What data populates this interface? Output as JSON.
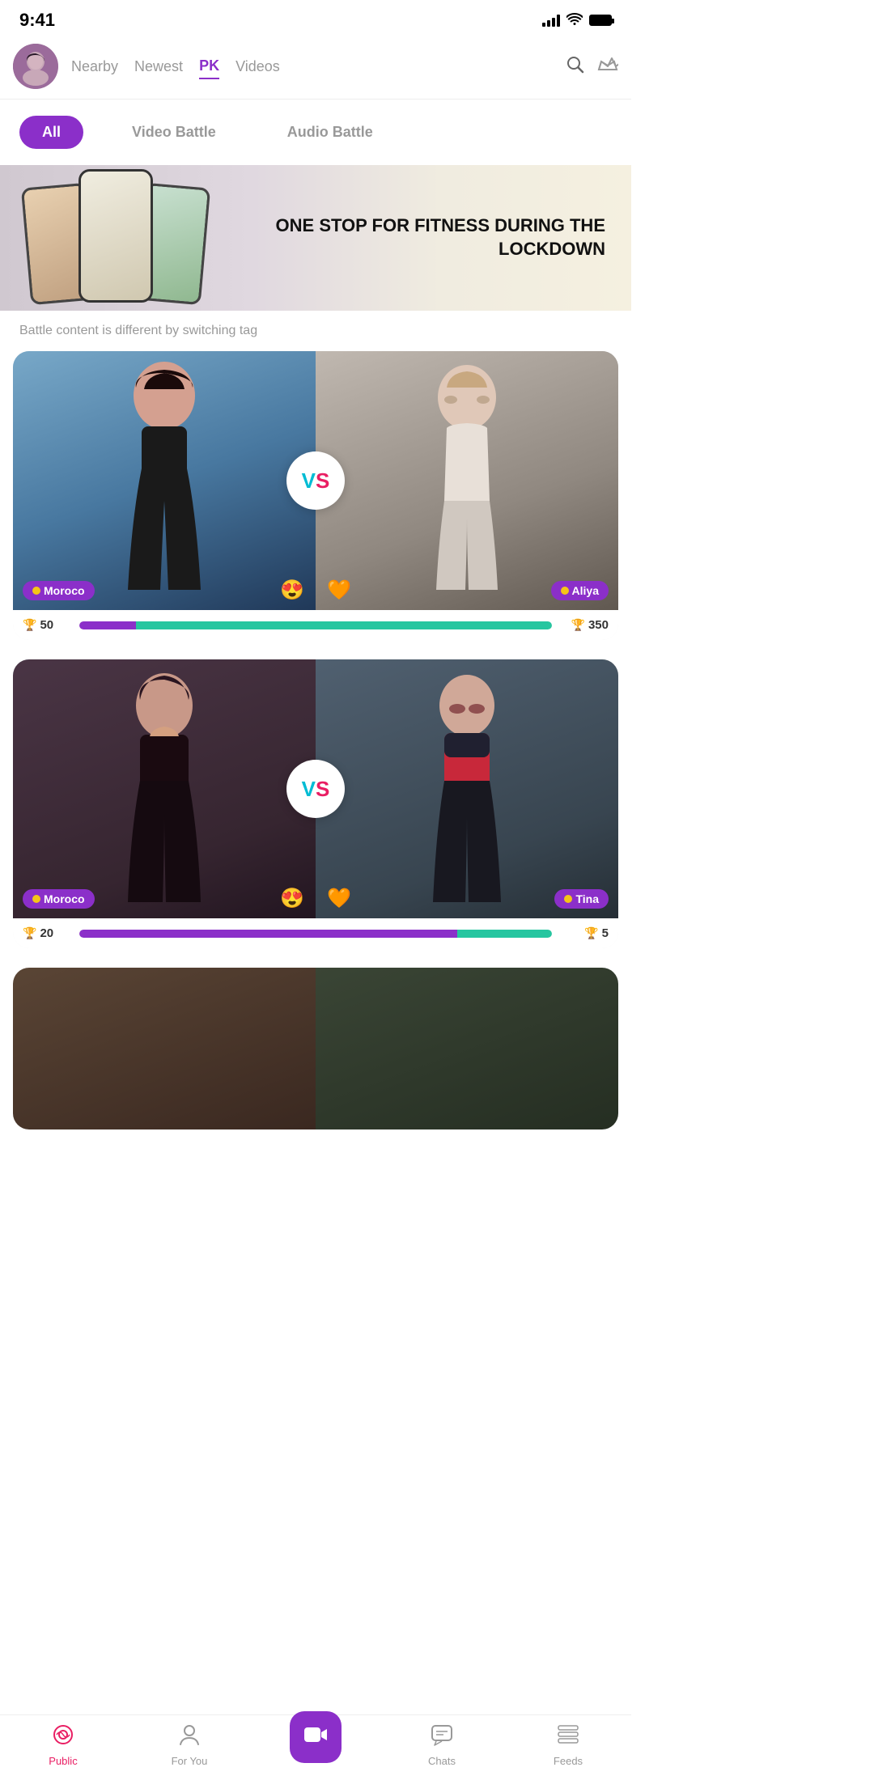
{
  "statusBar": {
    "time": "9:41",
    "signal": "full",
    "wifi": "on",
    "battery": "full"
  },
  "header": {
    "navTabs": [
      {
        "id": "nearby",
        "label": "Nearby",
        "active": false
      },
      {
        "id": "newest",
        "label": "Newest",
        "active": false
      },
      {
        "id": "pk",
        "label": "PK",
        "active": true
      },
      {
        "id": "videos",
        "label": "Videos",
        "active": false
      }
    ]
  },
  "filterBar": {
    "buttons": [
      {
        "id": "all",
        "label": "All",
        "active": true
      },
      {
        "id": "video-battle",
        "label": "Video Battle",
        "active": false
      },
      {
        "id": "audio-battle",
        "label": "Audio Battle",
        "active": false
      }
    ]
  },
  "banner": {
    "text": "ONE STOP FOR FITNESS\nDURING THE LOCKDOWN"
  },
  "subtitle": "Battle content is different by switching tag",
  "battles": [
    {
      "id": "battle-1",
      "leftPlayer": {
        "name": "Moroco",
        "emoji": "😍"
      },
      "rightPlayer": {
        "name": "Aliya",
        "emoji": "🧡"
      },
      "leftScore": 50,
      "rightScore": 350,
      "leftPercent": 12,
      "rightPercent": 88,
      "vsText": "VS"
    },
    {
      "id": "battle-2",
      "leftPlayer": {
        "name": "Moroco",
        "emoji": "😍"
      },
      "rightPlayer": {
        "name": "Tina",
        "emoji": "🧡"
      },
      "leftScore": 20,
      "rightScore": 5,
      "leftPercent": 80,
      "rightPercent": 20,
      "vsText": "VS"
    }
  ],
  "bottomNav": {
    "items": [
      {
        "id": "public",
        "label": "Public",
        "icon": "📡",
        "active": true
      },
      {
        "id": "for-you",
        "label": "For You",
        "icon": "👤",
        "active": false
      },
      {
        "id": "go-live",
        "label": "Go Live",
        "icon": "🎥",
        "active": false
      },
      {
        "id": "chats",
        "label": "Chats",
        "icon": "💬",
        "active": false
      },
      {
        "id": "feeds",
        "label": "Feeds",
        "icon": "📋",
        "active": false
      }
    ]
  },
  "colors": {
    "accent": "#8B2FC9",
    "teal": "#26C6A0",
    "pink": "#E91E63",
    "cyan": "#00BCD4",
    "gold": "#f5c518"
  }
}
